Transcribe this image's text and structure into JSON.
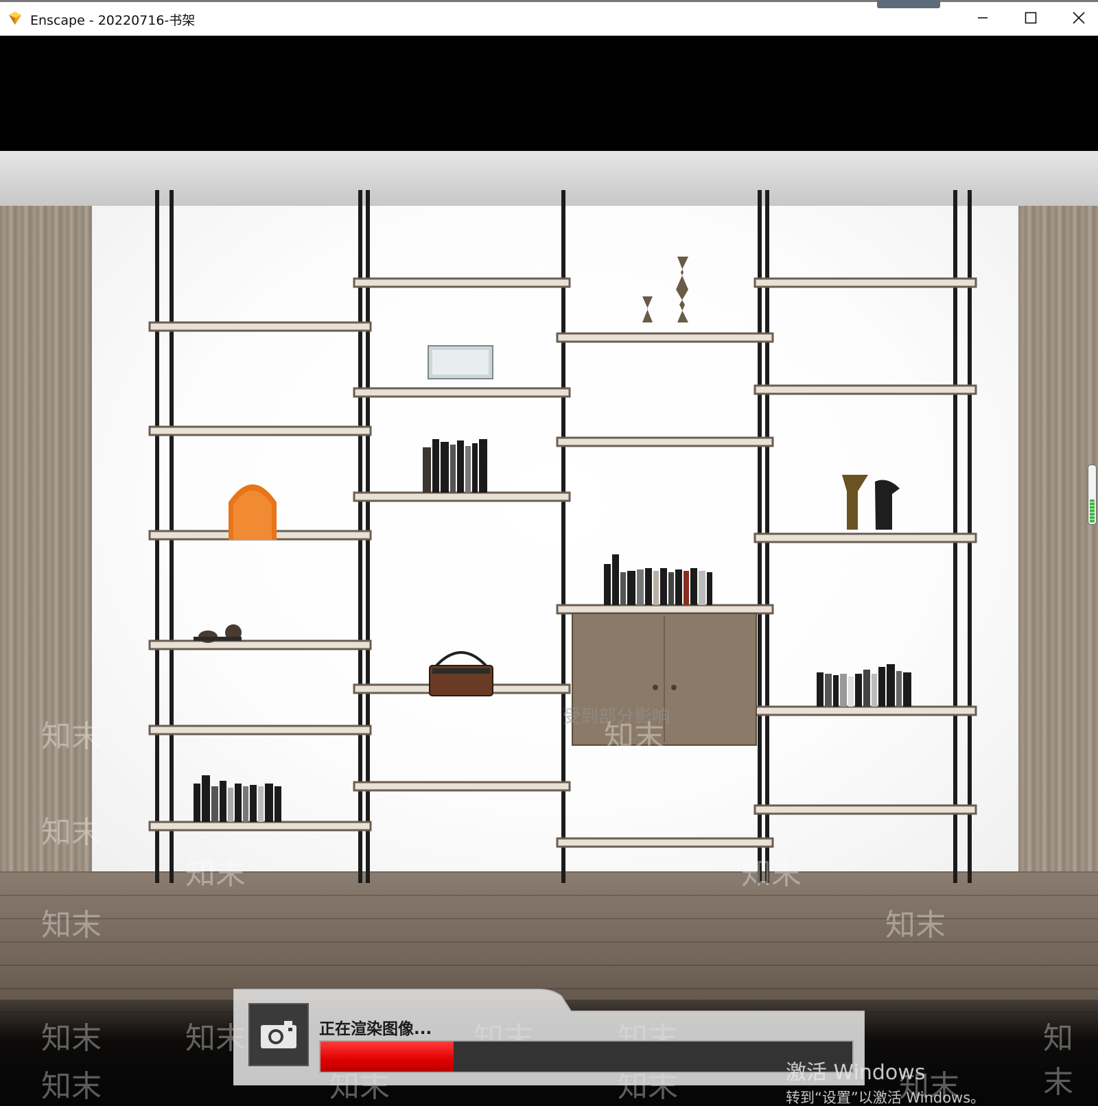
{
  "window": {
    "title": "Enscape - 20220716-书架",
    "minimize_icon": "minimize-icon",
    "maximize_icon": "maximize-icon",
    "close_icon": "close-icon"
  },
  "watermark": {
    "text": "知末",
    "notice": "受到部分影响"
  },
  "render": {
    "label": "正在渲染图像...",
    "progress": 0.25,
    "icon": "camera-icon",
    "color": "#e00000"
  },
  "activation": {
    "line1": "激活 Windows",
    "line2": "转到“设置”以激活 Windows。"
  },
  "colors": {
    "accent_app": "#f0a020",
    "progress": "#e00000",
    "handle": "#3bb33b"
  }
}
